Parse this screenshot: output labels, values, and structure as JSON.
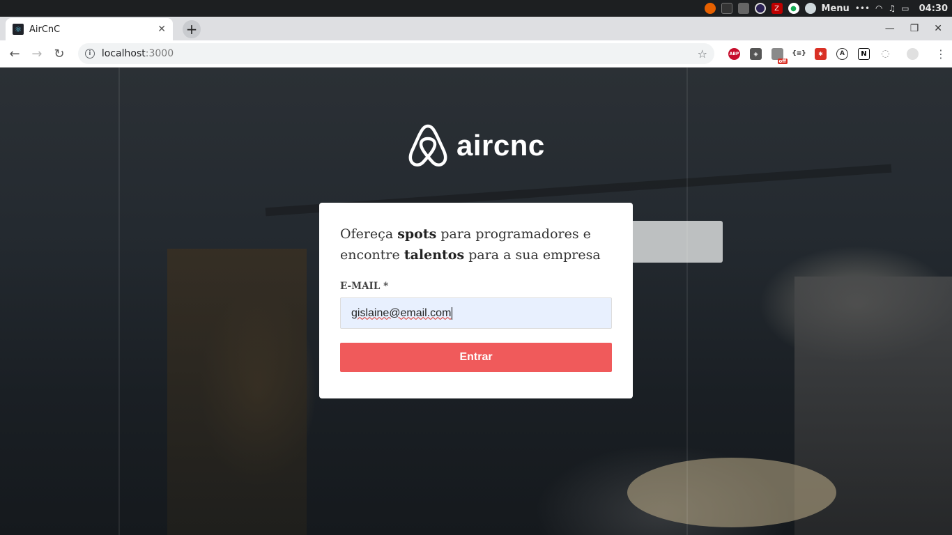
{
  "os_panel": {
    "menu_label": "Menu",
    "clock": "04:30",
    "tray_icons": [
      "firefox-icon",
      "terminal-icon",
      "folder-icon",
      "eclipse-icon",
      "filezilla-icon",
      "mongodb-icon",
      "user-avatar-icon",
      "more-icon",
      "wifi-icon",
      "music-icon",
      "battery-icon"
    ]
  },
  "browser": {
    "tab": {
      "title": "AirCnC",
      "favicon": "react-icon"
    },
    "url": {
      "host": "localhost",
      "port": ":3000"
    },
    "extensions": [
      "adblock-plus-icon",
      "privacy-shield-icon",
      "extension-off-icon",
      "json-viewer-icon",
      "red-extension-icon",
      "a-extension-icon",
      "notion-icon",
      "settings-extension-icon"
    ],
    "ext_labels": {
      "abp": "ABP",
      "off": "off",
      "json": "{≡}",
      "a": "A",
      "n": "N"
    }
  },
  "page": {
    "logo_text": "aircnc",
    "card": {
      "text_part1": "Ofereça ",
      "text_bold1": "spots",
      "text_part2": " para programadores e encontre ",
      "text_bold2": "talentos",
      "text_part3": " para a sua empresa",
      "email_label": "E-MAIL *",
      "email_value": "gislaine@email.com",
      "submit_label": "Entrar"
    }
  },
  "colors": {
    "accent": "#f05a5b",
    "input_bg": "#e8f0fe"
  }
}
